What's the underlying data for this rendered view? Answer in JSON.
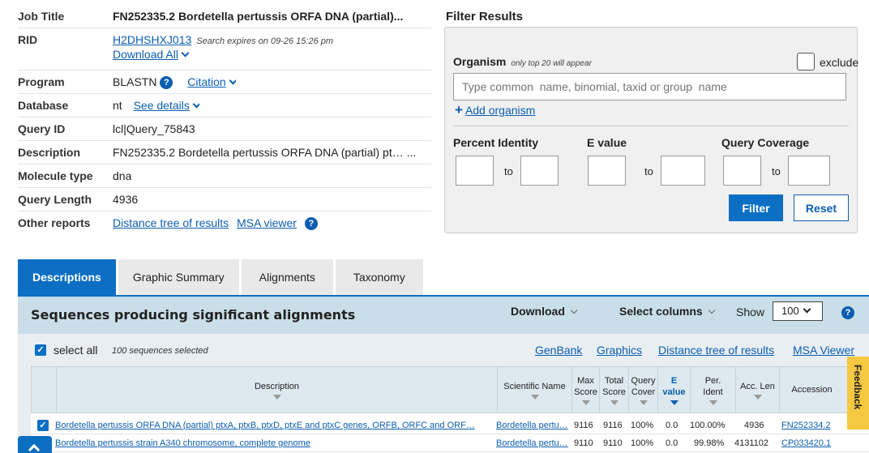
{
  "summary": {
    "job_title_key": "Job Title",
    "job_title": "FN252335.2 Bordetella pertussis ORFA DNA (partial)...",
    "rid_key": "RID",
    "rid": "H2DHSHXJ013",
    "rid_note": "Search expires on 09-26 15:26 pm",
    "download_all": "Download All",
    "program_key": "Program",
    "program": "BLASTN",
    "citation": "Citation",
    "database_key": "Database",
    "database": "nt",
    "see_details": "See details",
    "query_id_key": "Query ID",
    "query_id": "lcl|Query_75843",
    "description_key": "Description",
    "description": "FN252335.2 Bordetella pertussis ORFA DNA (partial) pt… ...",
    "molecule_type_key": "Molecule type",
    "molecule_type": "dna",
    "query_length_key": "Query Length",
    "query_length": "4936",
    "other_reports_key": "Other reports",
    "distance_tree": "Distance tree of results",
    "msa_viewer": "MSA viewer"
  },
  "filter": {
    "title": "Filter Results",
    "organism_label": "Organism",
    "organism_hint": "only top 20 will appear",
    "exclude": "exclude",
    "organism_placeholder": "Type common  name, binomial, taxid or group  name",
    "add_organism": "Add organism",
    "percent_identity": "Percent Identity",
    "e_value": "E value",
    "query_coverage": "Query Coverage",
    "to": "to",
    "filter_button": "Filter",
    "reset_button": "Reset"
  },
  "tabs": [
    "Descriptions",
    "Graphic Summary",
    "Alignments",
    "Taxonomy"
  ],
  "results": {
    "title": "Sequences producing significant alignments",
    "download": "Download",
    "select_columns": "Select columns",
    "show": "Show",
    "show_value": "100",
    "select_all": "select all",
    "selected_count": "100 sequences selected",
    "links": [
      "GenBank",
      "Graphics",
      "Distance tree of results",
      "MSA Viewer"
    ],
    "columns": {
      "description": "Description",
      "scientific_name": "Scientific Name",
      "max_score_1": "Max",
      "max_score_2": "Score",
      "total_score_1": "Total",
      "total_score_2": "Score",
      "query_cover_1": "Query",
      "query_cover_2": "Cover",
      "evalue_1": "E",
      "evalue_2": "value",
      "per_ident_1": "Per.",
      "per_ident_2": "Ident",
      "acc_len": "Acc. Len",
      "accession": "Accession"
    },
    "rows": [
      {
        "description": "Bordetella pertussis ORFA DNA (partial) ptxA, ptxB, ptxD, ptxE and ptxC genes, ORFB, ORFC and ORF…",
        "scientific_name": "Bordetella pertu…",
        "max_score": "9116",
        "total_score": "9116",
        "query_cover": "100%",
        "evalue": "0.0",
        "per_ident": "100.00%",
        "acc_len": "4936",
        "accession": "FN252334.2"
      },
      {
        "description": "Bordetella pertussis strain A340 chromosome, complete genome",
        "scientific_name": "Bordetella pertu…",
        "max_score": "9110",
        "total_score": "9110",
        "query_cover": "100%",
        "evalue": "0.0",
        "per_ident": "99.98%",
        "acc_len": "4131102",
        "accession": "CP033420.1"
      }
    ]
  },
  "feedback": "Feedback",
  "colors": {
    "primary": "#0c6fc4",
    "link": "#0c5eb0",
    "header_band": "#c9dee8",
    "feedback": "#f5c842"
  }
}
